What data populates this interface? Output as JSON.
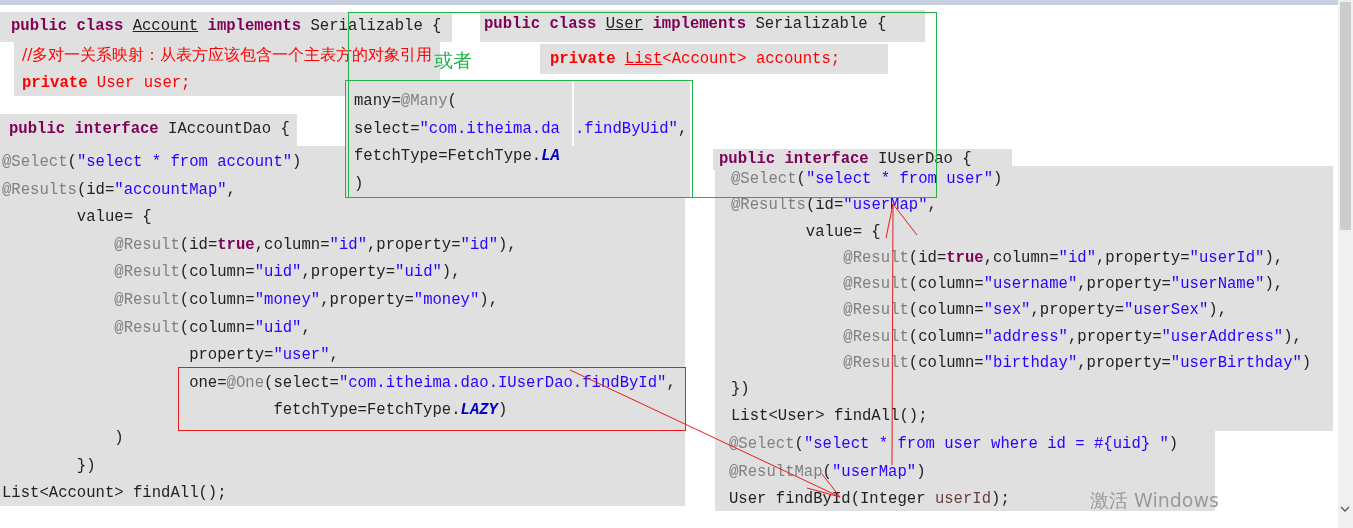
{
  "code_blocks": [
    {
      "lines": [
        [
          {
            "kind": "keyword",
            "text": "public class "
          },
          {
            "kind": "underline",
            "text": "Account"
          },
          {
            "kind": "keyword",
            "text": " implements"
          },
          {
            "kind": "plain",
            "text": " Serializable {"
          }
        ]
      ]
    },
    {
      "lines": [
        [
          {
            "kind": "keyword",
            "text": "public class "
          },
          {
            "kind": "underline",
            "text": "User"
          },
          {
            "kind": "keyword",
            "text": " implements"
          },
          {
            "kind": "plain",
            "text": " Serializable {"
          }
        ]
      ]
    },
    {
      "lines": [
        [
          {
            "kind": "comment",
            "text": "//多对一关系映射：从表方应该包含一个主表方的对象引用"
          }
        ],
        [
          {
            "kind": "strong",
            "text": "private"
          },
          {
            "kind": "red",
            "text": " User user;"
          }
        ]
      ]
    },
    {
      "lines": [
        [
          {
            "kind": "strong",
            "text": "private "
          },
          {
            "kind": "redline",
            "text": "List"
          },
          {
            "kind": "red",
            "text": "<Account> accounts;"
          }
        ]
      ]
    },
    {
      "lines": [
        [
          {
            "kind": "keyword",
            "text": "public interface"
          },
          {
            "kind": "plain",
            "text": " IAccountDao {"
          }
        ]
      ]
    },
    {
      "lines": [
        [
          {
            "kind": "plain",
            "text": "many="
          },
          {
            "kind": "annotation",
            "text": "@Many"
          },
          {
            "kind": "plain",
            "text": "("
          }
        ],
        [
          {
            "kind": "plain",
            "text": "select="
          },
          {
            "kind": "string",
            "text": "\"com.itheima.da"
          }
        ],
        [
          {
            "kind": "plain",
            "text": "fetchType=FetchType."
          },
          {
            "kind": "constant",
            "text": "LA"
          }
        ],
        [
          {
            "kind": "plain",
            "text": ")"
          }
        ]
      ]
    },
    {
      "lines": [
        [
          {
            "kind": "string",
            "text": ".findByUid\""
          },
          {
            "kind": "plain",
            "text": ","
          }
        ]
      ]
    },
    {
      "lines": [
        [
          {
            "kind": "annotation",
            "text": "@Select"
          },
          {
            "kind": "plain",
            "text": "("
          },
          {
            "kind": "string",
            "text": "\"select * from account\""
          },
          {
            "kind": "plain",
            "text": ")"
          }
        ],
        [
          {
            "kind": "annotation",
            "text": "@Results"
          },
          {
            "kind": "plain",
            "text": "(id="
          },
          {
            "kind": "string",
            "text": "\"accountMap\""
          },
          {
            "kind": "plain",
            "text": ","
          }
        ],
        [
          {
            "kind": "plain",
            "text": "        value= {"
          }
        ],
        [
          {
            "kind": "annotation",
            "text": "            @Result"
          },
          {
            "kind": "plain",
            "text": "(id="
          },
          {
            "kind": "keyword",
            "text": "true"
          },
          {
            "kind": "plain",
            "text": ",column="
          },
          {
            "kind": "string",
            "text": "\"id\""
          },
          {
            "kind": "plain",
            "text": ",property="
          },
          {
            "kind": "string",
            "text": "\"id\""
          },
          {
            "kind": "plain",
            "text": "),"
          }
        ],
        [
          {
            "kind": "annotation",
            "text": "            @Result"
          },
          {
            "kind": "plain",
            "text": "(column="
          },
          {
            "kind": "string",
            "text": "\"uid\""
          },
          {
            "kind": "plain",
            "text": ",property="
          },
          {
            "kind": "string",
            "text": "\"uid\""
          },
          {
            "kind": "plain",
            "text": "),"
          }
        ],
        [
          {
            "kind": "annotation",
            "text": "            @Result"
          },
          {
            "kind": "plain",
            "text": "(column="
          },
          {
            "kind": "string",
            "text": "\"money\""
          },
          {
            "kind": "plain",
            "text": ",property="
          },
          {
            "kind": "string",
            "text": "\"money\""
          },
          {
            "kind": "plain",
            "text": "),"
          }
        ],
        [
          {
            "kind": "annotation",
            "text": "            @Result"
          },
          {
            "kind": "plain",
            "text": "(column="
          },
          {
            "kind": "string",
            "text": "\"uid\""
          },
          {
            "kind": "plain",
            "text": ","
          }
        ],
        [
          {
            "kind": "plain",
            "text": "                    property="
          },
          {
            "kind": "string",
            "text": "\"user\""
          },
          {
            "kind": "plain",
            "text": ","
          }
        ],
        [
          {
            "kind": "plain",
            "text": "                    one="
          },
          {
            "kind": "annotation",
            "text": "@One"
          },
          {
            "kind": "plain",
            "text": "(select="
          },
          {
            "kind": "string",
            "text": "\"com.itheima.dao.IUserDao.findById\""
          },
          {
            "kind": "plain",
            "text": ","
          }
        ],
        [
          {
            "kind": "plain",
            "text": "                             fetchType=FetchType."
          },
          {
            "kind": "constant",
            "text": "LAZY"
          },
          {
            "kind": "plain",
            "text": ")"
          }
        ],
        [
          {
            "kind": "plain",
            "text": "            )"
          }
        ],
        [
          {
            "kind": "plain",
            "text": "        })"
          }
        ],
        [
          {
            "kind": "plain",
            "text": "List<Account> findAll();"
          }
        ]
      ]
    },
    {
      "lines": [
        [
          {
            "kind": "keyword",
            "text": "public interface"
          },
          {
            "kind": "plain",
            "text": " IUserDao {"
          }
        ]
      ]
    },
    {
      "lines": [
        [
          {
            "kind": "annotation",
            "text": "@Select"
          },
          {
            "kind": "plain",
            "text": "("
          },
          {
            "kind": "string",
            "text": "\"select * from user\""
          },
          {
            "kind": "plain",
            "text": ")"
          }
        ],
        [
          {
            "kind": "annotation",
            "text": "@Results"
          },
          {
            "kind": "plain",
            "text": "(id="
          },
          {
            "kind": "string",
            "text": "\"userMap\""
          },
          {
            "kind": "plain",
            "text": ","
          }
        ],
        [
          {
            "kind": "plain",
            "text": "        value= {"
          }
        ],
        [
          {
            "kind": "annotation",
            "text": "            @Result"
          },
          {
            "kind": "plain",
            "text": "(id="
          },
          {
            "kind": "keyword",
            "text": "true"
          },
          {
            "kind": "plain",
            "text": ",column="
          },
          {
            "kind": "string",
            "text": "\"id\""
          },
          {
            "kind": "plain",
            "text": ",property="
          },
          {
            "kind": "string",
            "text": "\"userId\""
          },
          {
            "kind": "plain",
            "text": "),"
          }
        ],
        [
          {
            "kind": "annotation",
            "text": "            @Result"
          },
          {
            "kind": "plain",
            "text": "(column="
          },
          {
            "kind": "string",
            "text": "\"username\""
          },
          {
            "kind": "plain",
            "text": ",property="
          },
          {
            "kind": "string",
            "text": "\"userName\""
          },
          {
            "kind": "plain",
            "text": "),"
          }
        ],
        [
          {
            "kind": "annotation",
            "text": "            @Result"
          },
          {
            "kind": "plain",
            "text": "(column="
          },
          {
            "kind": "string",
            "text": "\"sex\""
          },
          {
            "kind": "plain",
            "text": ",property="
          },
          {
            "kind": "string",
            "text": "\"userSex\""
          },
          {
            "kind": "plain",
            "text": "),"
          }
        ],
        [
          {
            "kind": "annotation",
            "text": "            @Result"
          },
          {
            "kind": "plain",
            "text": "(column="
          },
          {
            "kind": "string",
            "text": "\"address\""
          },
          {
            "kind": "plain",
            "text": ",property="
          },
          {
            "kind": "string",
            "text": "\"userAddress\""
          },
          {
            "kind": "plain",
            "text": "),"
          }
        ],
        [
          {
            "kind": "annotation",
            "text": "            @Result"
          },
          {
            "kind": "plain",
            "text": "(column="
          },
          {
            "kind": "string",
            "text": "\"birthday\""
          },
          {
            "kind": "plain",
            "text": ",property="
          },
          {
            "kind": "string",
            "text": "\"userBirthday\""
          },
          {
            "kind": "plain",
            "text": ")"
          }
        ],
        [
          {
            "kind": "plain",
            "text": "})"
          }
        ],
        [
          {
            "kind": "plain",
            "text": "List<User> findAll();"
          }
        ]
      ]
    },
    {
      "lines": [
        [
          {
            "kind": "annotation",
            "text": "@Select"
          },
          {
            "kind": "plain",
            "text": "("
          },
          {
            "kind": "string",
            "text": "\"select * from user where id = #{uid} \""
          },
          {
            "kind": "plain",
            "text": ")"
          }
        ],
        [
          {
            "kind": "annotation",
            "text": "@ResultMap"
          },
          {
            "kind": "plain",
            "text": "("
          },
          {
            "kind": "string",
            "text": "\"userMap\""
          },
          {
            "kind": "plain",
            "text": ")"
          }
        ],
        [
          {
            "kind": "plain",
            "text": "User findById(Integer "
          },
          {
            "kind": "variable",
            "text": "userId"
          },
          {
            "kind": "plain",
            "text": ");"
          }
        ]
      ]
    }
  ],
  "note": "或者",
  "activation_notice": {
    "title": "激活 Windows"
  }
}
